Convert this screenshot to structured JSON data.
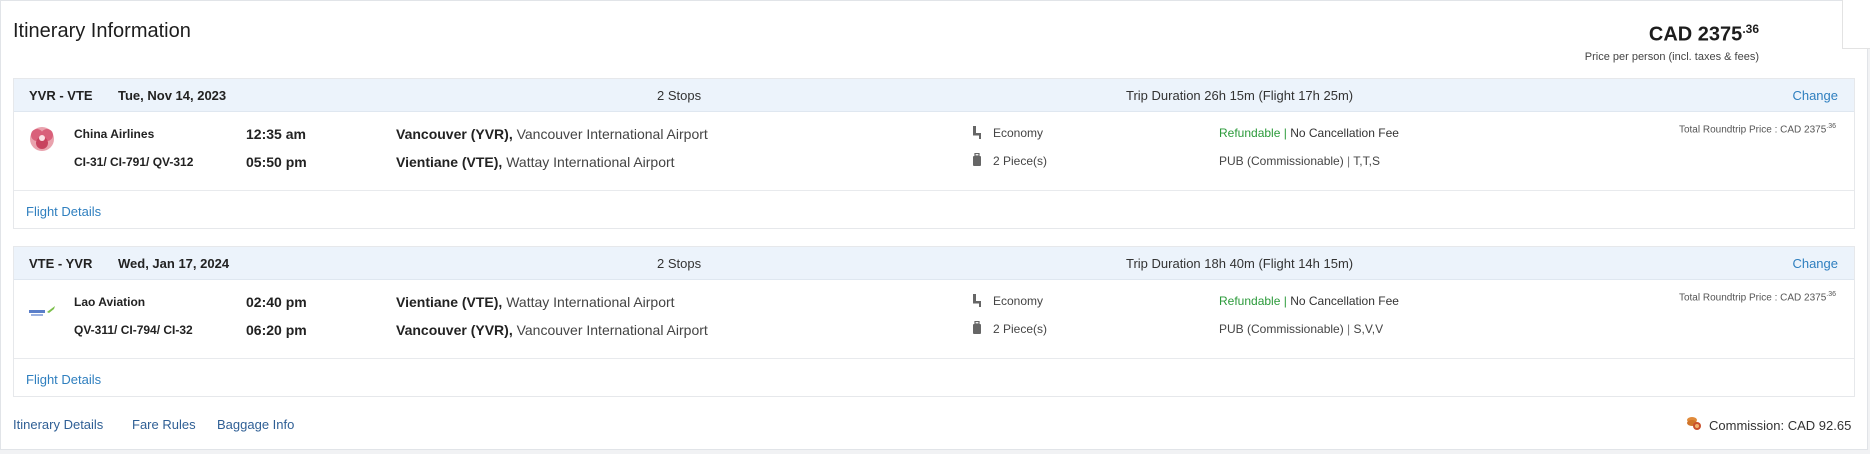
{
  "header": {
    "title": "Itinerary Information",
    "price_main": "CAD 2375",
    "price_cents": ".36",
    "price_sub": "Price per person (incl. taxes & fees)"
  },
  "segments": [
    {
      "route": "YVR - VTE",
      "date": "Tue, Nov 14, 2023",
      "stops": "2 Stops",
      "trip_duration": "Trip Duration 26h 15m (Flight 17h 25m)",
      "change_label": "Change",
      "airline": "China Airlines",
      "logo_icon": "china-airlines-logo-icon",
      "flight_numbers": "CI-31/ CI-791/ QV-312",
      "dep_time": "12:35 am",
      "arr_time": "05:50 pm",
      "dep_place_code": "Vancouver (YVR),",
      "dep_place_name": " Vancouver International Airport",
      "arr_place_code": "Vientiane (VTE),",
      "arr_place_name": " Wattay International Airport",
      "cabin": "Economy",
      "baggage": "2 Piece(s)",
      "refundable": "Refundable",
      "refund_sep": " | ",
      "no_cancel": "No Cancellation Fee",
      "pub": "PUB (Commissionable)",
      "pub_sep": " | ",
      "fare_class": "T,T,S",
      "total_price": "Total Roundtrip Price : CAD 2375",
      "total_cents": ".36",
      "flight_details_label": "Flight Details"
    },
    {
      "route": "VTE - YVR",
      "date": "Wed, Jan 17, 2024",
      "stops": "2 Stops",
      "trip_duration": "Trip Duration 18h 40m (Flight 14h 15m)",
      "change_label": "Change",
      "airline": "Lao Aviation",
      "logo_icon": "lao-aviation-logo-icon",
      "flight_numbers": "QV-311/ CI-794/ CI-32",
      "dep_time": "02:40 pm",
      "arr_time": "06:20 pm",
      "dep_place_code": "Vientiane (VTE),",
      "dep_place_name": " Wattay International Airport",
      "arr_place_code": "Vancouver (YVR),",
      "arr_place_name": " Vancouver International Airport",
      "cabin": "Economy",
      "baggage": "2 Piece(s)",
      "refundable": "Refundable",
      "refund_sep": " | ",
      "no_cancel": "No Cancellation Fee",
      "pub": "PUB (Commissionable)",
      "pub_sep": " | ",
      "fare_class": "S,V,V",
      "total_price": "Total Roundtrip Price : CAD 2375",
      "total_cents": ".36",
      "flight_details_label": "Flight Details"
    }
  ],
  "footer": {
    "itinerary_details": "Itinerary Details",
    "fare_rules": "Fare Rules",
    "baggage_info": "Baggage Info",
    "commission": "Commission: CAD 92.65",
    "commission_icon": "coins-icon"
  },
  "colors": {
    "link": "#2f7fbf",
    "green": "#2b9a3a",
    "header_bg": "#ecf3fb"
  }
}
